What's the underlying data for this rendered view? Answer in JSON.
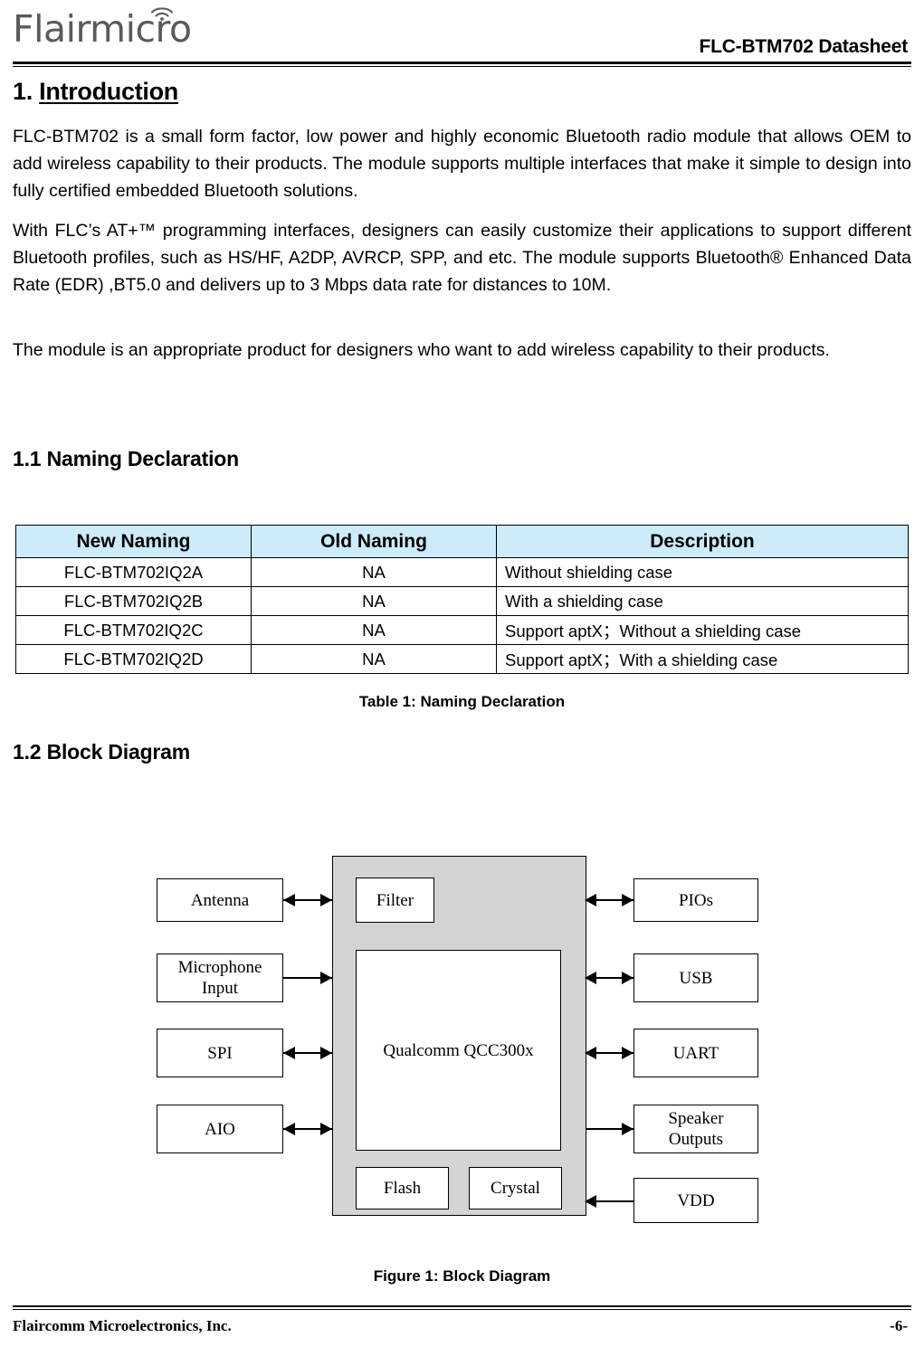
{
  "header": {
    "logo_text": "Flairmicro",
    "logo_icon": "wifi-icon",
    "document_title": "FLC-BTM702 Datasheet"
  },
  "sections": {
    "intro": {
      "number": "1. ",
      "title": "Introduction",
      "paragraphs": [
        "FLC-BTM702 is a small form factor, low power and highly economic Bluetooth radio module that allows OEM to add wireless capability to their products. The module supports multiple interfaces that make it simple to design into fully certified embedded Bluetooth solutions.",
        "With FLC’s AT+™ programming interfaces, designers can easily customize their applications to support different Bluetooth profiles, such as HS/HF, A2DP, AVRCP, SPP, and etc. The module supports Bluetooth® Enhanced Data Rate (EDR) ,BT5.0 and delivers up to 3 Mbps data rate for distances to 10M.",
        "The module is an appropriate product for designers who want to add wireless capability to their products."
      ]
    },
    "naming": {
      "heading": "1.1 Naming Declaration",
      "table": {
        "columns": [
          "New Naming",
          "Old Naming",
          "Description"
        ],
        "rows": [
          [
            "FLC-BTM702IQ2A",
            "NA",
            "Without shielding case"
          ],
          [
            "FLC-BTM702IQ2B",
            "NA",
            "With a shielding case"
          ],
          [
            "FLC-BTM702IQ2C",
            "NA",
            "Support aptX；Without a shielding case"
          ],
          [
            "FLC-BTM702IQ2D",
            "NA",
            "Support aptX；With a shielding case"
          ]
        ]
      },
      "caption": "Table 1: Naming Declaration"
    },
    "block_diagram": {
      "heading": "1.2 Block Diagram",
      "caption": "Figure 1: Block Diagram",
      "left_blocks": [
        {
          "label": "Antenna",
          "arrow": "bidirectional"
        },
        {
          "label": "Microphone\nInput",
          "line1": "Microphone",
          "line2": "Input",
          "arrow": "to-module"
        },
        {
          "label": "SPI",
          "arrow": "bidirectional"
        },
        {
          "label": "AIO",
          "arrow": "bidirectional"
        }
      ],
      "right_blocks": [
        {
          "label": "PIOs",
          "arrow": "bidirectional"
        },
        {
          "label": "USB",
          "arrow": "bidirectional"
        },
        {
          "label": "UART",
          "arrow": "bidirectional"
        },
        {
          "label": "Speaker\nOutputs",
          "line1": "Speaker",
          "line2": "Outputs",
          "arrow": "from-module"
        },
        {
          "label": "VDD",
          "arrow": "to-module"
        }
      ],
      "module_blocks": [
        {
          "label": "Filter"
        },
        {
          "label": "Qualcomm QCC300x"
        },
        {
          "label": "Flash"
        },
        {
          "label": "Crystal"
        }
      ],
      "module_fill": "#D4D4D4"
    }
  },
  "footer": {
    "company": "Flaircomm Microelectronics, Inc.",
    "page_number": "-6-"
  }
}
